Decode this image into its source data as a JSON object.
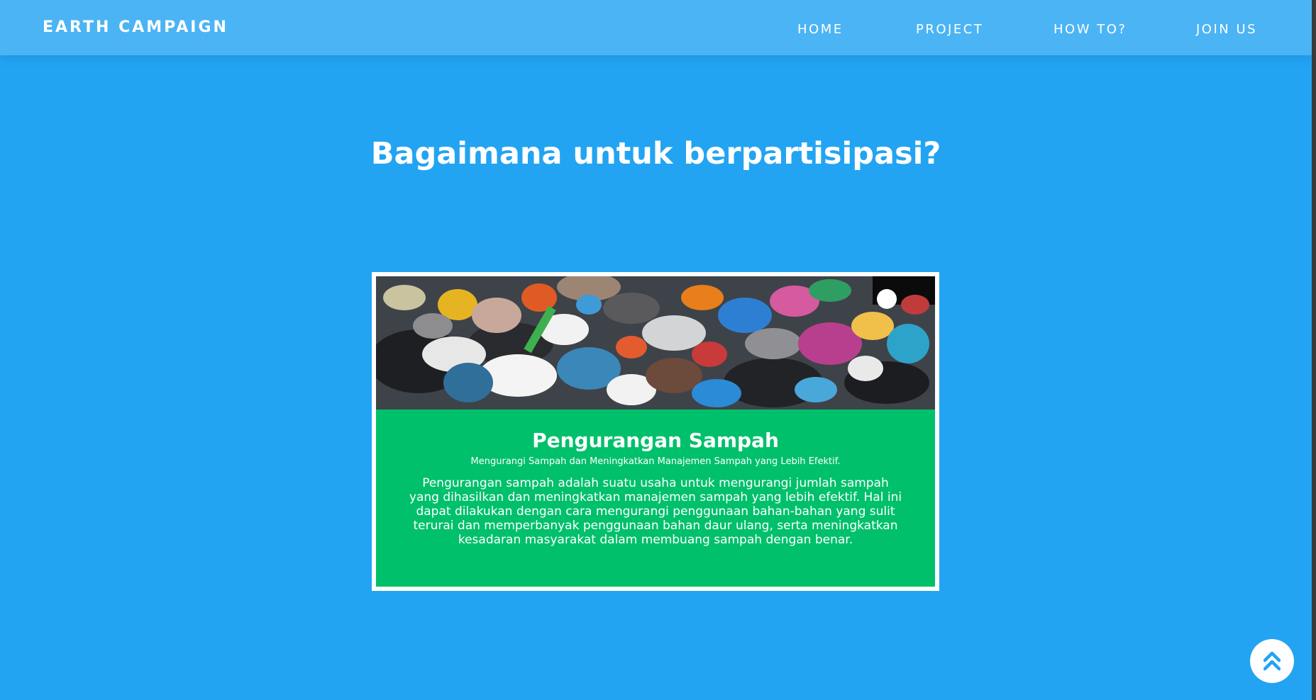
{
  "navbar": {
    "brand": "EARTH CAMPAIGN",
    "links": [
      {
        "label": "HOME"
      },
      {
        "label": "PROJECT"
      },
      {
        "label": "HOW TO?"
      },
      {
        "label": "JOIN US"
      }
    ]
  },
  "main": {
    "title": "Bagaimana untuk berpartisipasi?",
    "card": {
      "image_icon": "garbage-pile-photo",
      "title": "Pengurangan Sampah",
      "subtitle": "Mengurangi Sampah dan Meningkatkan Manajemen Sampah yang Lebih Efektif.",
      "text": "Pengurangan sampah adalah suatu usaha untuk mengurangi jumlah sampah yang dihasilkan dan meningkatkan manajemen sampah yang lebih efektif. Hal ini dapat dilakukan dengan cara mengurangi penggunaan bahan-bahan yang sulit terurai dan memperbanyak penggunaan bahan daur ulang, serta meningkatkan kesadaran masyarakat dalam membuang sampah dengan benar."
    }
  },
  "back_to_top": {
    "icon": "double-chevron-up-icon"
  },
  "colors": {
    "background": "#22a4f2",
    "navbar": "#4bb4f4",
    "card_body": "#00c06b",
    "text": "#ffffff"
  }
}
